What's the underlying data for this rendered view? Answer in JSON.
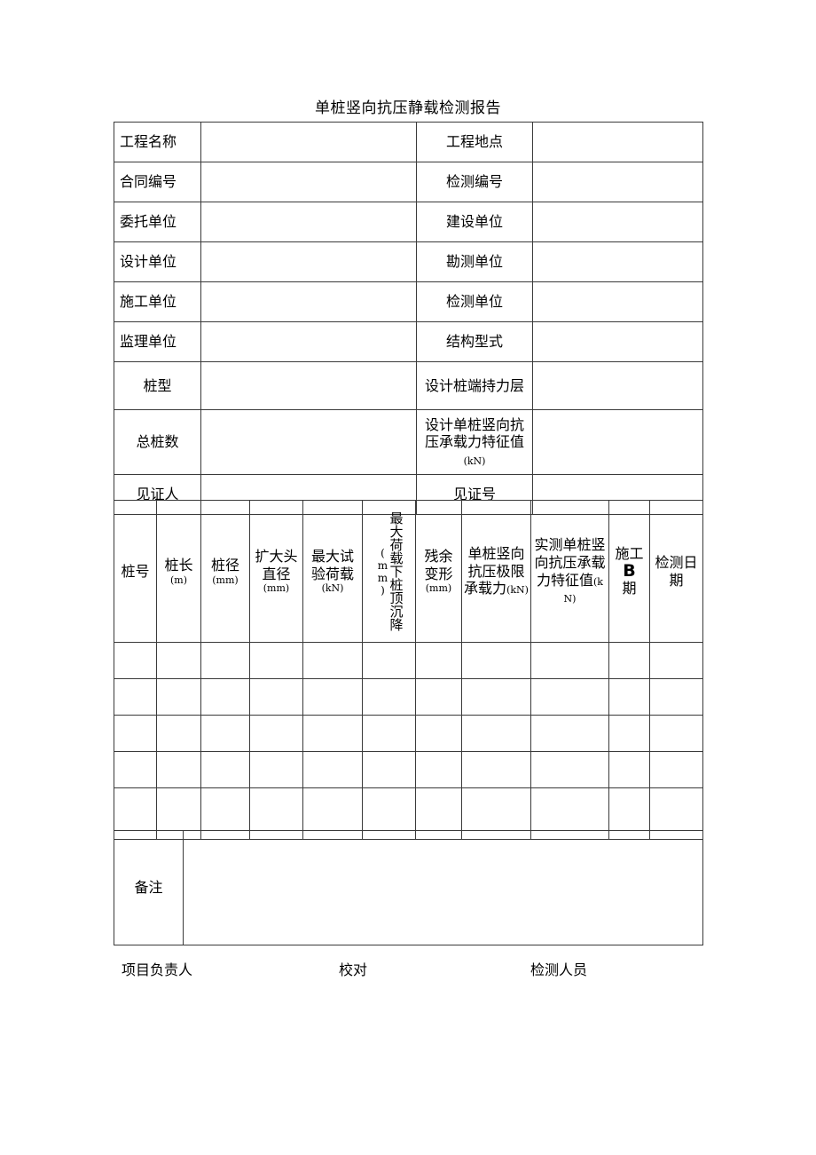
{
  "document": {
    "title": "单桩竖向抗压静载检测报告"
  },
  "info_table": {
    "rows": [
      {
        "label_left": "工程名称",
        "value_left": "",
        "label_right": "工程地点",
        "value_right": "",
        "align": "left"
      },
      {
        "label_left": "合同编号",
        "value_left": "",
        "label_right": "检测编号",
        "value_right": "",
        "align": "left"
      },
      {
        "label_left": "委托单位",
        "value_left": "",
        "label_right": "建设单位",
        "value_right": "",
        "align": "left"
      },
      {
        "label_left": "设计单位",
        "value_left": "",
        "label_right": "勘测单位",
        "value_right": "",
        "align": "left"
      },
      {
        "label_left": "施工单位",
        "value_left": "",
        "label_right": "检测单位",
        "value_right": "",
        "align": "left"
      },
      {
        "label_left": "监理单位",
        "value_left": "",
        "label_right": "结构型式",
        "value_right": "",
        "align": "left"
      },
      {
        "label_left": "桩型",
        "value_left": "",
        "label_right": "设计桩端持力层",
        "value_right": "",
        "align": "center"
      },
      {
        "label_left": "总桩数",
        "value_left": "",
        "label_right": "设计单桩竖向抗压承载力特征值",
        "label_right_unit": "(kN)",
        "value_right": "",
        "align": "center"
      },
      {
        "label_left": "见证人",
        "value_left": "",
        "label_right": "见证号",
        "value_right": "",
        "align": "center"
      }
    ]
  },
  "pile_table": {
    "headers": [
      {
        "text": "桩号",
        "unit": "",
        "orientation": "horizontal"
      },
      {
        "text": "桩长",
        "unit": "(m)",
        "orientation": "horizontal"
      },
      {
        "text": "桩径",
        "unit": "(mm)",
        "orientation": "horizontal"
      },
      {
        "text": "扩大头直径",
        "unit": "(mm)",
        "orientation": "horizontal"
      },
      {
        "text": "最大试验荷载",
        "unit": "(kN)",
        "orientation": "horizontal"
      },
      {
        "text": "最大荷载下桩顶沉降",
        "unit": "(mm)",
        "orientation": "vertical"
      },
      {
        "text": "残余变形",
        "unit": "(mm)",
        "orientation": "horizontal"
      },
      {
        "text": "单桩竖向抗压极限承载力",
        "unit": "(kN)",
        "orientation": "horizontal"
      },
      {
        "text": "实测单桩竖向抗压承载力特征值",
        "unit": "(kN)",
        "orientation": "horizontal"
      },
      {
        "text_part1": "施工",
        "text_glyph": "B",
        "text_part2": "期",
        "text": "施工日期",
        "unit": "",
        "orientation": "horizontal"
      },
      {
        "text": "检测日期",
        "unit": "",
        "orientation": "horizontal"
      }
    ],
    "data_rows": [
      [
        "",
        "",
        "",
        "",
        "",
        "",
        "",
        "",
        "",
        "",
        ""
      ],
      [
        "",
        "",
        "",
        "",
        "",
        "",
        "",
        "",
        "",
        "",
        ""
      ],
      [
        "",
        "",
        "",
        "",
        "",
        "",
        "",
        "",
        "",
        "",
        ""
      ],
      [
        "",
        "",
        "",
        "",
        "",
        "",
        "",
        "",
        "",
        "",
        ""
      ],
      [
        "",
        "",
        "",
        "",
        "",
        "",
        "",
        "",
        "",
        "",
        ""
      ]
    ]
  },
  "remarks": {
    "label": "备注",
    "value": ""
  },
  "footer": {
    "items": [
      {
        "label": "项目负责人",
        "value": ""
      },
      {
        "label": "校对",
        "value": ""
      },
      {
        "label": "检测人员",
        "value": ""
      }
    ]
  }
}
